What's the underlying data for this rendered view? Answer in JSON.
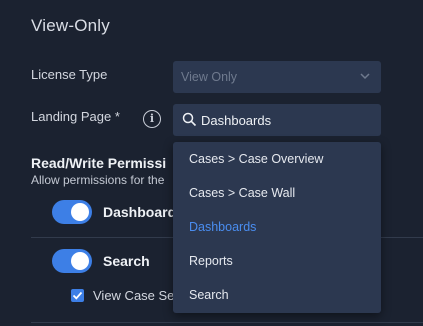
{
  "section": {
    "title": "View-Only"
  },
  "license": {
    "label": "License Type",
    "value": "View Only"
  },
  "landing": {
    "label": "Landing Page *",
    "value": "Dashboards",
    "options": [
      {
        "label": "Cases > Case Overview"
      },
      {
        "label": "Cases > Case Wall"
      },
      {
        "label": "Dashboards"
      },
      {
        "label": "Reports"
      },
      {
        "label": "Search"
      }
    ],
    "selected_index": 2
  },
  "permissions": {
    "title": "Read/Write Permissi",
    "subtitle": "Allow permissions for the",
    "items": [
      {
        "label": "Dashboard",
        "enabled": true
      },
      {
        "label": "Search",
        "enabled": true
      }
    ],
    "sub_checkbox": {
      "label": "View Case Se",
      "checked": true
    }
  },
  "colors": {
    "accent": "#3d7fe6",
    "background": "#1b2230",
    "field": "#2c3850"
  }
}
